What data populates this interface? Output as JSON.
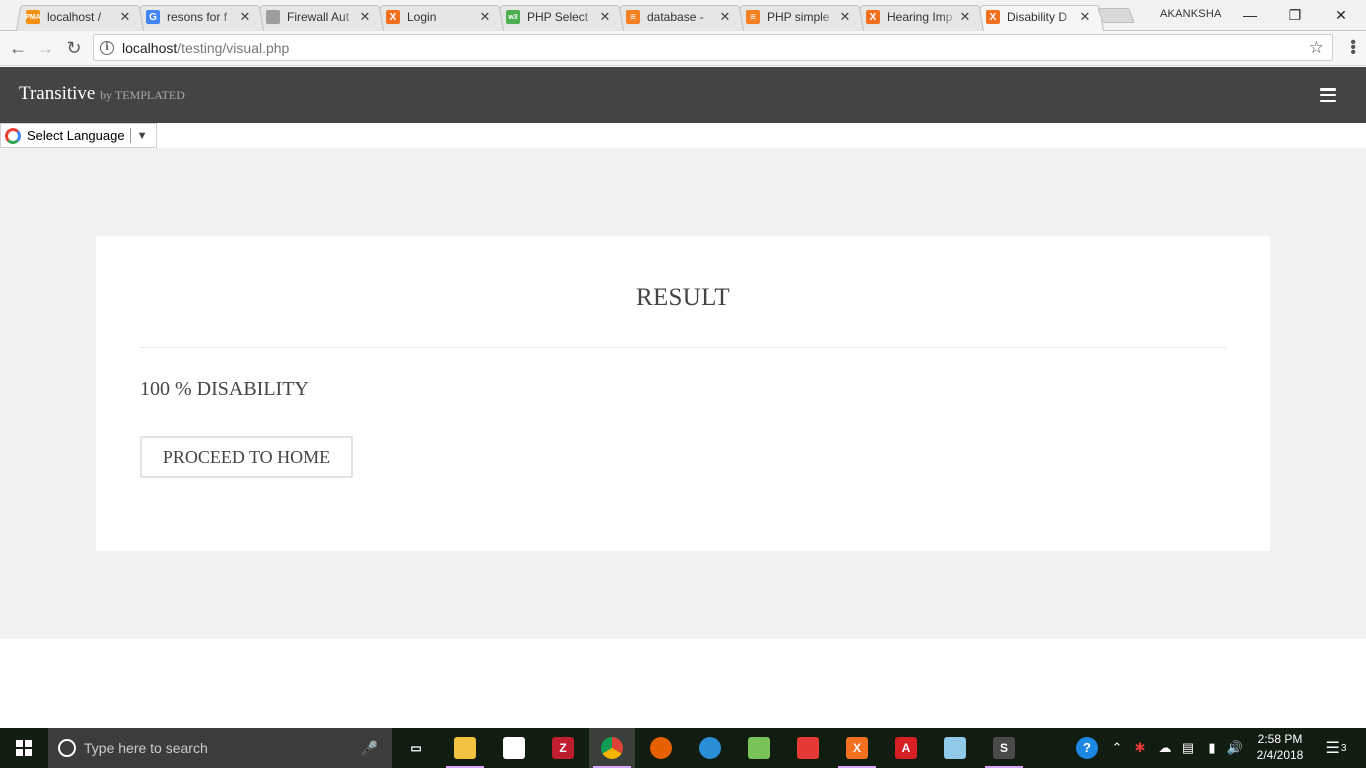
{
  "browser": {
    "tabs": [
      {
        "title": "localhost / ",
        "favicon": "phpmyadmin-icon",
        "color": "#f29111",
        "glyph": "PMA"
      },
      {
        "title": "resons for f",
        "favicon": "google-icon",
        "color": "#4285f4",
        "glyph": "G"
      },
      {
        "title": "Firewall Aut",
        "favicon": "document-icon",
        "color": "#9e9e9e",
        "glyph": ""
      },
      {
        "title": "Login",
        "favicon": "xampp-icon",
        "color": "#f37021",
        "glyph": "X"
      },
      {
        "title": "PHP Select",
        "favicon": "w3schools-icon",
        "color": "#4caf50",
        "glyph": "w3"
      },
      {
        "title": "database - ",
        "favicon": "stackoverflow-icon",
        "color": "#f48024",
        "glyph": "≡"
      },
      {
        "title": "PHP simple",
        "favicon": "stackoverflow-icon",
        "color": "#f48024",
        "glyph": "≡"
      },
      {
        "title": "Hearing Imp",
        "favicon": "xampp-icon",
        "color": "#f37021",
        "glyph": "X"
      },
      {
        "title": "Disability D",
        "favicon": "xampp-icon",
        "color": "#f37021",
        "glyph": "X",
        "active": true
      }
    ],
    "profile_name": "AKANKSHA",
    "url_host": "localhost",
    "url_path": "/testing/visual.php"
  },
  "site": {
    "brand": "Transitive",
    "brand_by": "by TEMPLATED",
    "translate_label": "Select Language",
    "translate_arrow": "▼"
  },
  "result": {
    "title": "RESULT",
    "value_text": "100 % DISABILITY",
    "button_label": "PROCEED TO HOME"
  },
  "taskbar": {
    "search_placeholder": "Type here to search",
    "apps": [
      {
        "name": "task-view-icon",
        "color": "transparent",
        "glyph": "▭"
      },
      {
        "name": "file-explorer-icon",
        "color": "#f4c242",
        "glyph": "",
        "running": true
      },
      {
        "name": "store-icon",
        "color": "#ffffff",
        "glyph": ""
      },
      {
        "name": "filezilla-icon",
        "color": "#bf1e2e",
        "glyph": "Z"
      },
      {
        "name": "chrome-icon",
        "color": "#db4437",
        "glyph": "",
        "running": true,
        "active": true
      },
      {
        "name": "firefox-icon",
        "color": "#e66000",
        "glyph": ""
      },
      {
        "name": "ubuntu-icon",
        "color": "#2a8fd6",
        "glyph": ""
      },
      {
        "name": "android-studio-icon",
        "color": "#78c257",
        "glyph": ""
      },
      {
        "name": "colors-app-icon",
        "color": "#e53935",
        "glyph": ""
      },
      {
        "name": "xampp-taskbar-icon",
        "color": "#f37021",
        "glyph": "X",
        "running": true
      },
      {
        "name": "acrobat-icon",
        "color": "#d71f26",
        "glyph": "A"
      },
      {
        "name": "notepad-icon",
        "color": "#8fc9e8",
        "glyph": ""
      },
      {
        "name": "sublime-icon",
        "color": "#4a4a4a",
        "glyph": "S",
        "running": true
      }
    ],
    "time": "2:58 PM",
    "date": "2/4/2018",
    "notification_count": "3"
  }
}
